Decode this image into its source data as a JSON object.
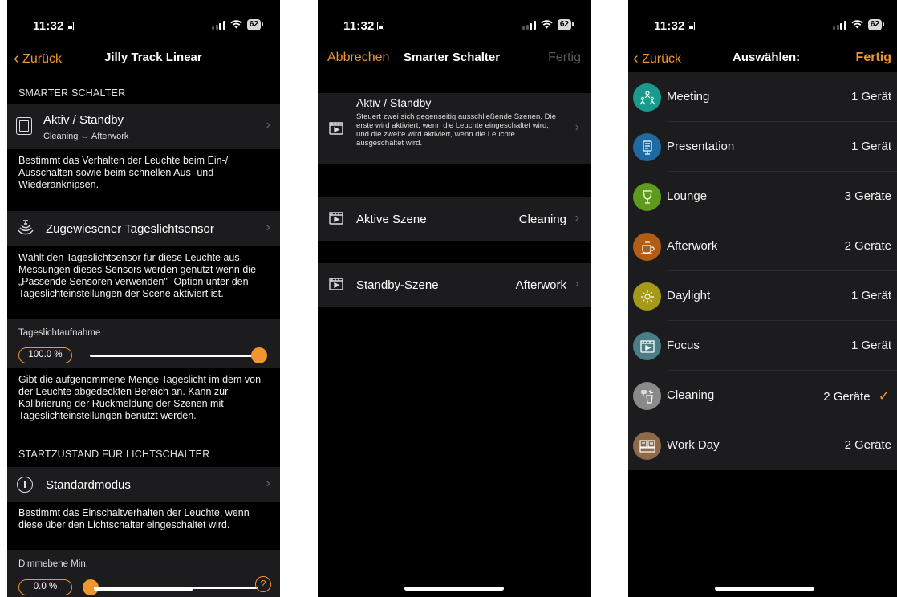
{
  "status": {
    "time": "11:32",
    "battery": "62"
  },
  "screen1": {
    "nav": {
      "back": "Zurück",
      "title": "Jilly Track Linear"
    },
    "section_smart": "SMARTER SCHALTER",
    "active_standby": {
      "title": "Aktiv / Standby",
      "subtitle": "Cleaning ⇔ Afterwork"
    },
    "desc1": "Bestimmt das Verhalten der Leuchte beim Ein-/ Ausschalten sowie beim schnellen Aus- und Wiederanknipsen.",
    "sensor_label": "Zugewiesener Tageslichtsensor",
    "desc2": "Wählt den Tageslichtsensor für diese Leuchte aus. Messungen dieses Sensors werden genutzt wenn die „Passende Sensoren verwenden\" -Option unter den Tageslichteinstellungen der Scene aktiviert ist.",
    "daylight_label": "Tageslichtaufnahme",
    "daylight_value": "100.0 %",
    "daylight_fraction": 1.0,
    "desc3": "Gibt die aufgenommene Menge Tageslicht im dem von der Leuchte abgedeckten Bereich an. Kann zur Kalibrierung der Rückmeldung der Szenen mit Tageslichteinstellungen benutzt werden.",
    "section_start": "STARTZUSTAND FÜR LICHTSCHALTER",
    "standard_mode": "Standardmodus",
    "desc4": "Bestimmt das Einschaltverhalten der Leuchte, wenn diese über den Lichtschalter eingeschaltet wird.",
    "dim_label": "Dimmebene Min.",
    "dim_value": "0.0 %",
    "dim_fraction": 0.0
  },
  "screen2": {
    "nav": {
      "cancel": "Abbrechen",
      "title": "Smarter Schalter",
      "done": "Fertig"
    },
    "active_standby": {
      "title": "Aktiv / Standby",
      "desc": "Steuert zwei sich gegenseitig ausschließende Szenen. Die erste wird aktiviert, wenn die Leuchte eingeschaltet wird, und die zweite wird aktiviert, wenn die Leuchte ausgeschaltet wird."
    },
    "active_scene": {
      "label": "Aktive Szene",
      "value": "Cleaning"
    },
    "standby_scene": {
      "label": "Standby-Szene",
      "value": "Afterwork"
    }
  },
  "screen3": {
    "nav": {
      "back": "Zurück",
      "title": "Auswählen:",
      "done": "Fertig"
    },
    "scenes": [
      {
        "name": "Meeting",
        "count": "1 Gerät",
        "color": "#1a9a8c",
        "icon": "people-icon",
        "checked": false
      },
      {
        "name": "Presentation",
        "count": "1 Gerät",
        "color": "#1f6aa0",
        "icon": "presentation-icon",
        "checked": false
      },
      {
        "name": "Lounge",
        "count": "3 Geräte",
        "color": "#5e9a1e",
        "icon": "wine-glass-icon",
        "checked": false
      },
      {
        "name": "Afterwork",
        "count": "2 Geräte",
        "color": "#b35c14",
        "icon": "coffee-cup-icon",
        "checked": false
      },
      {
        "name": "Daylight",
        "count": "1 Gerät",
        "color": "#a59a18",
        "icon": "sun-icon",
        "checked": false
      },
      {
        "name": "Focus",
        "count": "1 Gerät",
        "color": "#4a7e86",
        "icon": "clapperboard-icon",
        "checked": false
      },
      {
        "name": "Cleaning",
        "count": "2 Geräte",
        "color": "#8a8a8a",
        "icon": "cleaning-icon",
        "checked": true
      },
      {
        "name": "Work Day",
        "count": "2 Geräte",
        "color": "#8c6a4a",
        "icon": "calendar-icon",
        "checked": false
      }
    ]
  }
}
